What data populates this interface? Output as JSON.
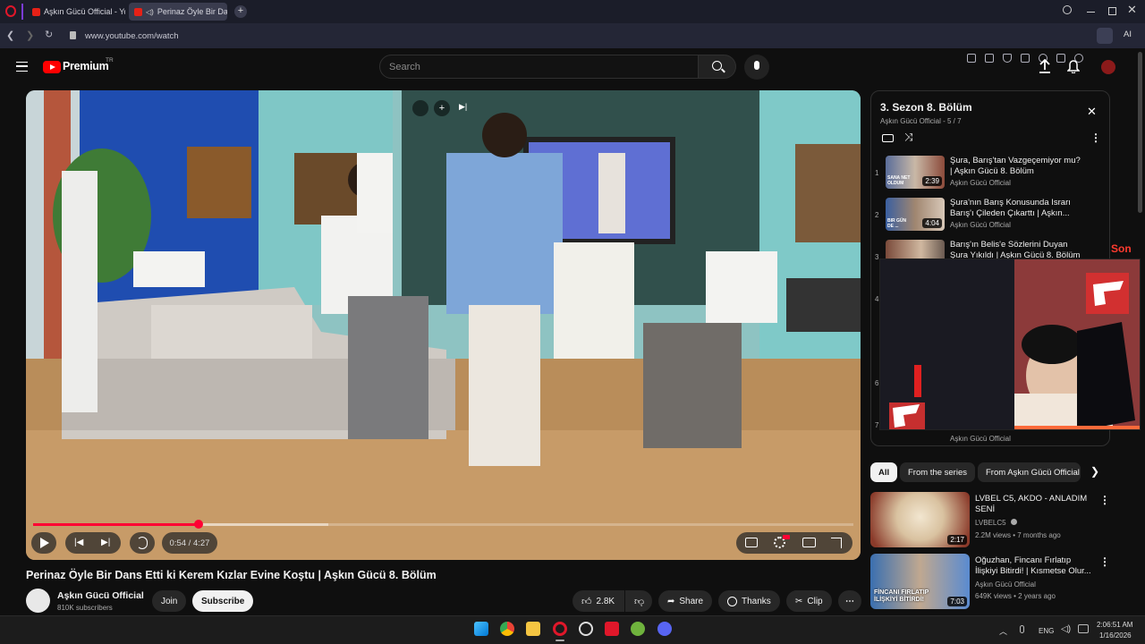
{
  "browser": {
    "tabs": [
      {
        "label": "Aşkın Gücü Official - YouT",
        "active": false
      },
      {
        "label": "Perinaz Öyle Bir Dans",
        "active": true
      }
    ],
    "url": "www.youtube.com/watch",
    "ai_label": "AI"
  },
  "youtube": {
    "logo_text": "Premium",
    "logo_region": "TR",
    "search_placeholder": "Search"
  },
  "player": {
    "time_current": "0:54",
    "time_separator": " / ",
    "time_total": "4:27",
    "progress_fraction": 0.202,
    "buffered_fraction": 0.36
  },
  "video": {
    "title": "Perinaz Öyle Bir Dans Etti ki Kerem Kızlar Evine Koştu | Aşkın Gücü 8. Bölüm",
    "channel": "Aşkın Gücü Official",
    "subscribers": "810K subscribers",
    "join_label": "Join",
    "subscribe_label": "Subscribe",
    "likes": "2.8K",
    "share_label": "Share",
    "thanks_label": "Thanks",
    "clip_label": "Clip"
  },
  "playlist": {
    "title": "3. Sezon 8. Bölüm",
    "subtitle": "Aşkın Gücü Official - 5 / 7",
    "items": [
      {
        "num": "1",
        "title": "Şura, Barış'tan Vazgeçemiyor mu? | Aşkın Gücü 8. Bölüm",
        "channel": "Aşkın Gücü Official",
        "duration": "2:39",
        "thumb_text": "SANA NET OLDUM"
      },
      {
        "num": "2",
        "title": "Şura'nın Barış Konusunda Israrı Barış'ı Çileden Çıkarttı | Aşkın...",
        "channel": "Aşkın Gücü Official",
        "duration": "4:04",
        "thumb_text": "BIR GÜN DE ..."
      },
      {
        "num": "3",
        "title": "Barış'ın Belis'e Sözlerini Duyan Şura Yıkıldı | Aşkın Gücü 8. Bölüm",
        "channel": "",
        "duration": "",
        "thumb_text": ""
      },
      {
        "num": "4",
        "title": "",
        "channel": "",
        "duration": "",
        "thumb_text": ""
      },
      {
        "num": "6",
        "title": "",
        "channel": "",
        "duration": "",
        "thumb_text": ""
      },
      {
        "num": "7",
        "title": "",
        "channel": "Aşkın Gücü Official",
        "duration": "",
        "thumb_text": ""
      }
    ]
  },
  "chips": [
    "All",
    "From the series",
    "From Aşkın Gücü Official"
  ],
  "recommendations": [
    {
      "title": "LVBEL C5, AKDO - ANLADIM SENİ",
      "channel": "LVBELC5",
      "meta": "2.2M views • 7 months ago",
      "duration": "2:17",
      "verified": true,
      "thumb_text": ""
    },
    {
      "title": "Oğuzhan, Fincanı Fırlatıp İlişkiyi Bitirdi! | Kısmetse Olur...",
      "channel": "Aşkın Gücü Official",
      "meta": "649K views • 2 years ago",
      "duration": "7:03",
      "verified": false,
      "thumb_text": "FİNCANI FIRLATIP İLİŞKİYİ BİTİRDİ!"
    }
  ],
  "side_text": "Son",
  "taskbar": {
    "lang": "ENG",
    "time": "2:06:51 AM",
    "date": "1/16/2026"
  },
  "colors": {
    "youtube_red": "#ff0000",
    "progress_red": "#ff0033",
    "browser_accent": "#c8102e"
  }
}
